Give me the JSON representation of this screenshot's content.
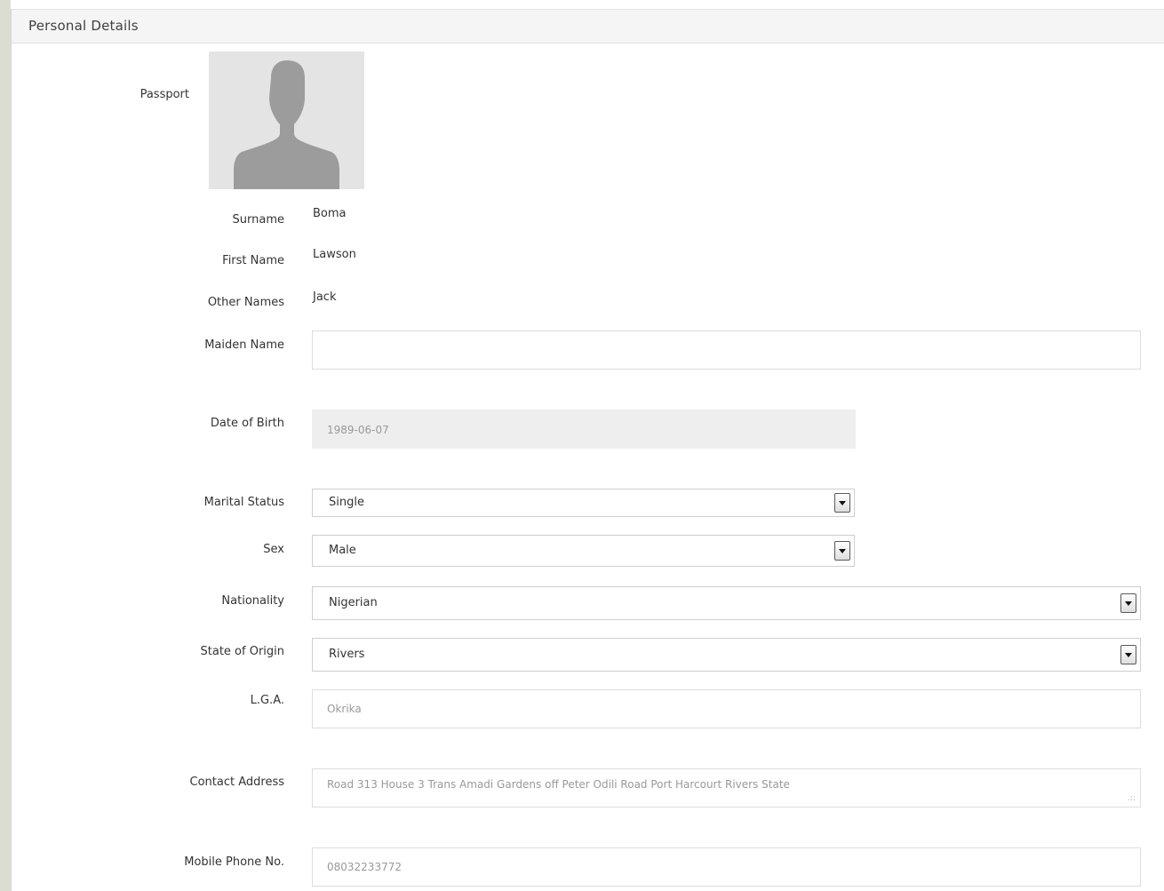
{
  "panel": {
    "title": "Personal Details"
  },
  "passport": {
    "label": "Passport",
    "icon": "user-silhouette-icon"
  },
  "fields": {
    "surname": {
      "label": "Surname",
      "value": "Boma"
    },
    "first_name": {
      "label": "First Name",
      "value": "Lawson"
    },
    "other_names": {
      "label": "Other Names",
      "value": "Jack"
    },
    "maiden_name": {
      "label": "Maiden Name",
      "value": ""
    },
    "date_of_birth": {
      "label": "Date of Birth",
      "value": "1989-06-07"
    },
    "marital_status": {
      "label": "Marital Status",
      "value": "Single"
    },
    "sex": {
      "label": "Sex",
      "value": "Male"
    },
    "nationality": {
      "label": "Nationality",
      "value": "Nigerian"
    },
    "state_of_origin": {
      "label": "State of Origin",
      "value": "Rivers"
    },
    "lga": {
      "label": "L.G.A.",
      "value": "Okrika"
    },
    "contact_address": {
      "label": "Contact Address",
      "value": "Road 313 House 3 Trans Amadi Gardens off Peter Odili Road Port Harcourt Rivers State"
    },
    "mobile_phone": {
      "label": "Mobile Phone No.",
      "value": "08032233772"
    }
  },
  "colors": {
    "heading_bg": "#f5f5f5",
    "readonly_bg": "#eeeeee",
    "placeholder_photo_bg": "#e4e4e4",
    "silhouette": "#9c9c9c"
  }
}
